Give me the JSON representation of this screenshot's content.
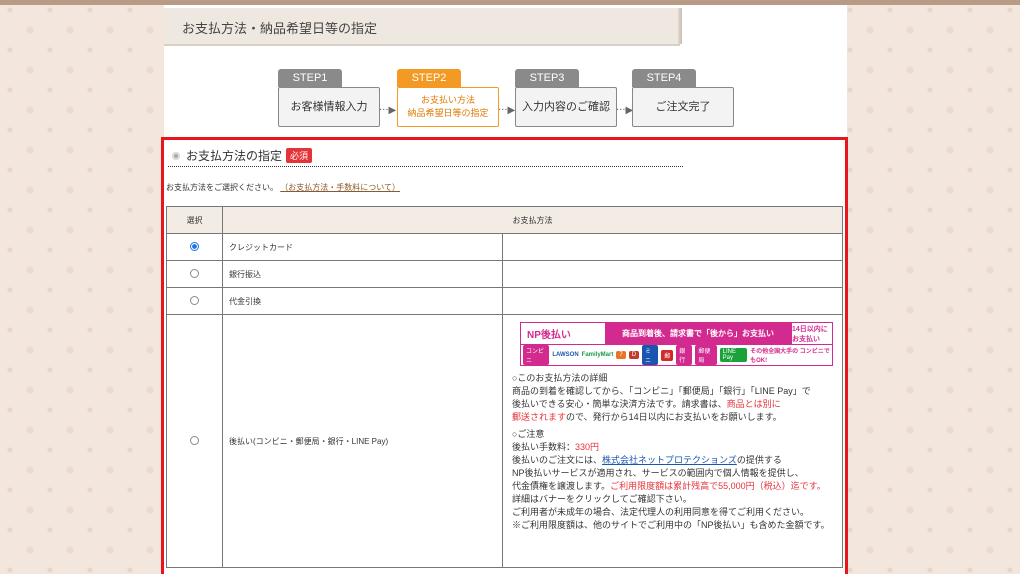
{
  "page_header": "お支払方法・納品希望日等の指定",
  "steps": [
    {
      "tab": "STEP1",
      "label": "お客様情報入力",
      "active": false
    },
    {
      "tab": "STEP2",
      "label_line1": "お支払い方法",
      "label_line2": "納品希望日等の指定",
      "active": true
    },
    {
      "tab": "STEP3",
      "label": "入力内容のご確認",
      "active": false
    },
    {
      "tab": "STEP4",
      "label": "ご注文完了",
      "active": false
    }
  ],
  "colors": {
    "step_inactive": "#8a8a8a",
    "step_active": "#f39a24",
    "required": "#e5333a",
    "frame": "#e8161a"
  },
  "section": {
    "title": "お支払方法の指定",
    "required_badge": "必須",
    "intro": "お支払方法をご選択ください。",
    "intro_link": "（お支払方法・手数料について）"
  },
  "table": {
    "headers": {
      "select": "選択",
      "method": "お支払方法"
    },
    "rows": [
      {
        "name": "クレジットカード",
        "selected": true
      },
      {
        "name": "銀行振込",
        "selected": false
      },
      {
        "name": "代金引換",
        "selected": false
      },
      {
        "name": "後払い(コンビニ・郵便局・銀行・LINE Pay)",
        "selected": false
      }
    ]
  },
  "np_banner": {
    "logo": "NP後払い",
    "message": "商品到着後、請求書で「後から」お支払い",
    "days": "14日以内に お支払い",
    "chips": [
      "コンビニ",
      "LAWSON",
      "FamilyMart",
      "7",
      "D",
      "ミニ",
      "郵",
      "銀行",
      "郵便局",
      "LINE Pay"
    ],
    "note": "その他全国大手の コンビニでもOK!"
  },
  "detail": {
    "h1": "○このお支払方法の詳細",
    "p1a": "商品の到着を確認してから、「コンビニ」「郵便局」「銀行」「LINE Pay」で",
    "p1b": "後払いできる安心・簡単な決済方法です。請求書は、",
    "p1c_red": "商品とは別に",
    "p1d_red": "郵送されます",
    "p1e": "ので、発行から14日以内にお支払いをお願いします。",
    "h2": "○ご注意",
    "fee_label": "後払い手数料：",
    "fee_value": "330円",
    "p2a": "後払いのご注文には、",
    "p2_link": "株式会社ネットプロテクションズ",
    "p2b": "の提供する",
    "p3": "NP後払いサービスが適用され、サービスの範囲内で個人情報を提供し、",
    "p4a": "代金債権を譲渡します。",
    "p4_red": "ご利用限度額は累計残高で55,000円（税込）迄です。",
    "p5": "詳細はバナーをクリックしてご確認下さい。",
    "p6": "ご利用者が未成年の場合、法定代理人の利用同意を得てご利用ください。",
    "p7": "※ご利用限度額は、他のサイトでご利用中の「NP後払い」も含めた金額です。"
  }
}
